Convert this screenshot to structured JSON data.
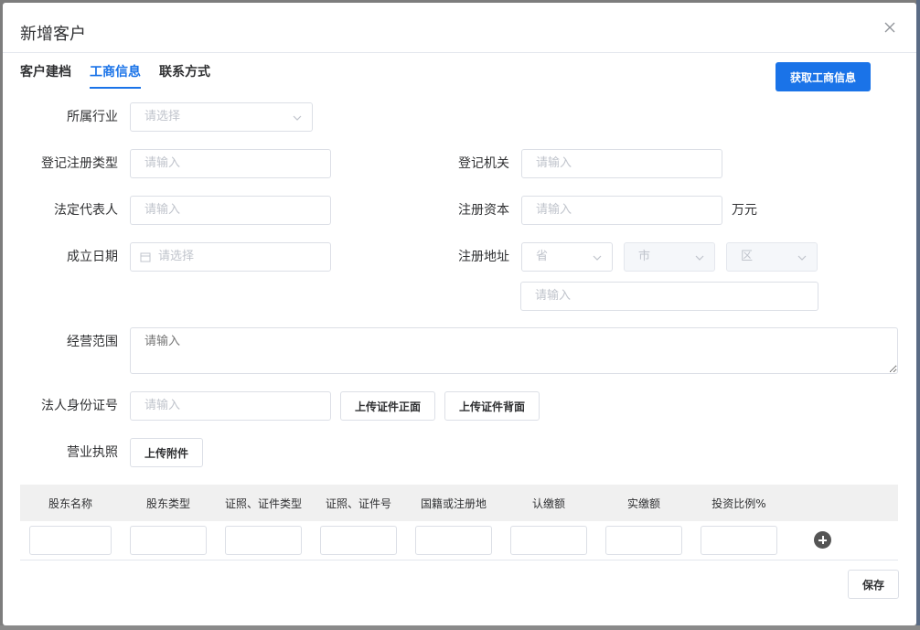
{
  "dialog": {
    "title": "新增客户"
  },
  "tabs": [
    {
      "label": "客户建档",
      "active": false
    },
    {
      "label": "工商信息",
      "active": true
    },
    {
      "label": "联系方式",
      "active": false
    }
  ],
  "fetch_button": "获取工商信息",
  "form": {
    "industry": {
      "label": "所属行业",
      "placeholder": "请选择"
    },
    "reg_type": {
      "label": "登记注册类型",
      "placeholder": "请输入"
    },
    "reg_authority": {
      "label": "登记机关",
      "placeholder": "请输入"
    },
    "legal_rep": {
      "label": "法定代表人",
      "placeholder": "请输入"
    },
    "reg_capital": {
      "label": "注册资本",
      "placeholder": "请输入",
      "unit": "万元"
    },
    "found_date": {
      "label": "成立日期",
      "placeholder": "请选择"
    },
    "reg_address": {
      "label": "注册地址",
      "province": "省",
      "city": "市",
      "district": "区",
      "detail_placeholder": "请输入"
    },
    "business_scope": {
      "label": "经营范围",
      "placeholder": "请输入"
    },
    "legal_id": {
      "label": "法人身份证号",
      "placeholder": "请输入",
      "upload_front": "上传证件正面",
      "upload_back": "上传证件背面"
    },
    "license": {
      "label": "营业执照",
      "upload": "上传附件"
    }
  },
  "shareholders_table": {
    "columns": [
      "股东名称",
      "股东类型",
      "证照、证件类型",
      "证照、证件号",
      "国籍或注册地",
      "认缴额",
      "实缴额",
      "投资比例%"
    ]
  },
  "save_button": "保存",
  "colors": {
    "accent": "#1a73e8"
  }
}
